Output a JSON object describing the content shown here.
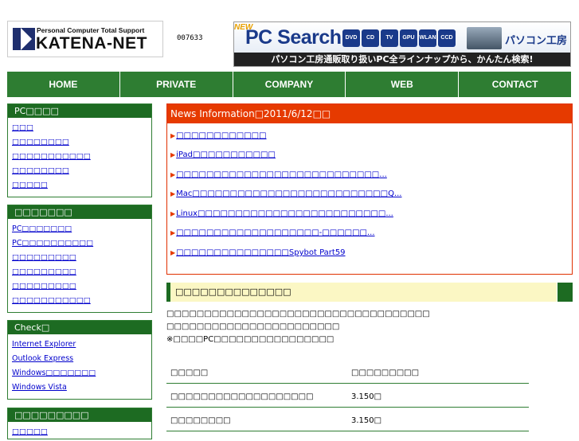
{
  "header": {
    "logo_tagline": "Personal Computer Total Support",
    "logo_name": "KATENA-NET",
    "counter": "007633",
    "banner": {
      "new_label": "NEW",
      "title": "PC Search",
      "chips": [
        "DVD",
        "CD",
        "TV",
        "GPU",
        "WLAN",
        "CCD"
      ],
      "shop_name": "パソコン工房",
      "tagline": "パソコン工房通販取り扱いPC全ラインナップから、かんたん検索!"
    }
  },
  "nav": [
    "HOME",
    "PRIVATE",
    "COMPANY",
    "WEB",
    "CONTACT"
  ],
  "sidebar": [
    {
      "title": "PC□□□□",
      "items": [
        "□□□",
        "□□□□□□□□",
        "□□□□□□□□□□□",
        "□□□□□□□□",
        "□□□□□"
      ]
    },
    {
      "title": "□□□□□□□",
      "items": [
        "PC□□□□□□□",
        "PC□□□□□□□□□□",
        "□□□□□□□□□",
        "□□□□□□□□□",
        "□□□□□□□□□",
        "□□□□□□□□□□□"
      ]
    },
    {
      "title": "Check□",
      "items": [
        "Internet Explorer",
        "Outlook Express",
        "Windows□□□□□□□",
        "Windows Vista"
      ]
    },
    {
      "title": "□□□□□□□□□",
      "items": [
        "□□□□□"
      ]
    }
  ],
  "news": {
    "title": "News Information□2011/6/12□□",
    "items": [
      {
        "pre": "",
        "mid": "□□□□□□□□□□□□",
        "post": ""
      },
      {
        "pre": "iPad",
        "mid": "□□□□□□□□□□□",
        "post": ""
      },
      {
        "pre": "",
        "mid": "□□□□□□□□□□□□□□□□□□□□□□□□□□□",
        "post": "..."
      },
      {
        "pre": "Mac",
        "mid": "□□□□□□□□□□□□□□□□□□□□□□□□□□Q",
        "post": "..."
      },
      {
        "pre": "Linux",
        "mid": "□□□□□□□□□□□□□□□□□□□□□□□□□",
        "post": "..."
      },
      {
        "pre": "",
        "mid": "□□□□□□□□□□□□□□□□□□□-□□□□□□",
        "post": "..."
      },
      {
        "pre": "",
        "mid": "□□□□□□□□□□□□□□□Spybot",
        "post": "Part59"
      }
    ]
  },
  "section": {
    "title": "□□□□□□□□□□□□□□",
    "paragraphs": [
      "□□□□□□□□□□□□□□□□□□□□□□□□□□□□□□□□□□□",
      "□□□□□□□□□□□□□□□□□□□□□□□",
      "※□□□□PC□□□□□□□□□□□□□□□□"
    ],
    "table": [
      [
        "□□□□□",
        "□□□□□□□□□"
      ],
      [
        "□□□□□□□□□□□□□□□□□□□",
        "3.150□"
      ],
      [
        "□□□□□□□□",
        "3.150□"
      ]
    ]
  },
  "colors": {
    "nav_green": "#2e7d32",
    "news_red": "#e63a00",
    "section_yellow": "#fbf7c4"
  }
}
